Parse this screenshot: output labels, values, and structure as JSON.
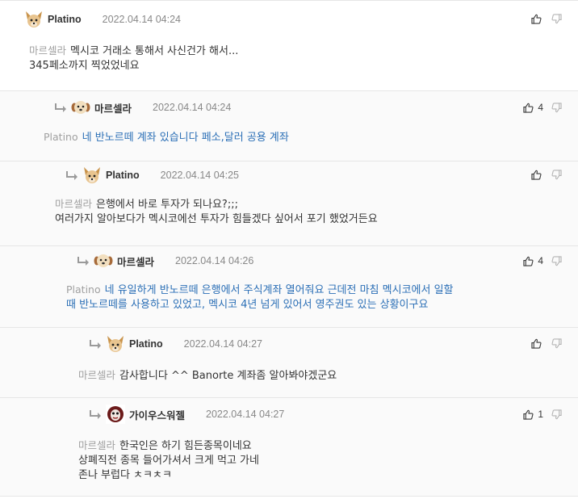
{
  "comments": [
    {
      "nick": "Platino",
      "date": "2022.04.14 04:24",
      "likes": "",
      "mention": "마르셀라",
      "lines": [
        "멕시코 거래소 통해서 사신건가 해서...",
        "345페소까지 찍었었네요"
      ],
      "text_color": "#333333"
    },
    {
      "nick": "마르셀라",
      "date": "2022.04.14 04:24",
      "likes": "4",
      "mention": "Platino",
      "lines": [
        "네 반노르떼 계좌 있습니다 페소,달러 공용 계좌"
      ],
      "text_color": "#2b6fb6"
    },
    {
      "nick": "Platino",
      "date": "2022.04.14 04:25",
      "likes": "",
      "mention": "마르셀라",
      "lines": [
        "은행에서 바로 투자가 되나요?;;;",
        "여러가지 알아보다가 멕시코에선 투자가 힘들겠다 싶어서 포기 했었거든요"
      ],
      "text_color": "#333333"
    },
    {
      "nick": "마르셀라",
      "date": "2022.04.14 04:26",
      "likes": "4",
      "mention": "Platino",
      "lines": [
        "네 유일하게 반노르떼 은행에서 주식계좌 열어줘요 근데전 마침 멕시코에서 일할",
        "때 반노르떼를 사용하고 있었고, 멕시코 4년 넘게 있어서 영주권도 있는 상황이구요"
      ],
      "text_color": "#2b6fb6"
    },
    {
      "nick": "Platino",
      "date": "2022.04.14 04:27",
      "likes": "",
      "mention": "마르셀라",
      "lines": [
        "감사합니다 ^^ Banorte 계좌좀 알아봐야겠군요"
      ],
      "text_color": "#333333"
    },
    {
      "nick": "가이우스워젤",
      "date": "2022.04.14 04:27",
      "likes": "1",
      "mention": "마르셀라",
      "lines": [
        "한국인은 하기 힘든종목이네요",
        "상폐직전 종목 들어가셔서 크게 먹고 가네",
        "존나 부럽다 ㅊㅋㅊㅋ"
      ],
      "text_color": "#333333"
    }
  ],
  "icons": {
    "reply_arrow": "reply-arrow-icon",
    "like": "thumbs-up-icon",
    "dislike": "thumbs-down-icon",
    "avatar_dog": "dog-avatar-icon",
    "avatar_puppy": "puppy-avatar-icon",
    "avatar_face": "face-avatar-icon"
  },
  "colors": {
    "nick": "#333333",
    "date": "#888888",
    "mention": "#a0a0a0",
    "blue_text": "#2b6fb6",
    "border": "#e6e6e6"
  }
}
